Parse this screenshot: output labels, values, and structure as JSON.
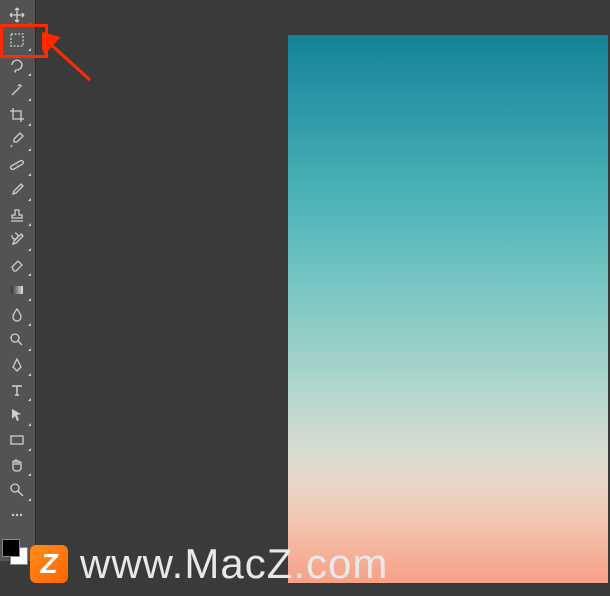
{
  "toolbar": {
    "tools": [
      {
        "name": "move-tool",
        "kind": "move"
      },
      {
        "name": "marquee-tool",
        "kind": "marquee",
        "highlighted": true
      },
      {
        "name": "lasso-tool",
        "kind": "lasso"
      },
      {
        "name": "magic-wand-tool",
        "kind": "wand"
      },
      {
        "name": "crop-tool",
        "kind": "crop"
      },
      {
        "name": "eyedropper-tool",
        "kind": "eyedropper"
      },
      {
        "name": "healing-brush-tool",
        "kind": "bandage"
      },
      {
        "name": "brush-tool",
        "kind": "brush"
      },
      {
        "name": "clone-stamp-tool",
        "kind": "stamp"
      },
      {
        "name": "history-brush-tool",
        "kind": "historybrush"
      },
      {
        "name": "eraser-tool",
        "kind": "eraser"
      },
      {
        "name": "gradient-tool",
        "kind": "gradient"
      },
      {
        "name": "blur-tool",
        "kind": "drop"
      },
      {
        "name": "dodge-tool",
        "kind": "dodge"
      },
      {
        "name": "pen-tool",
        "kind": "pen"
      },
      {
        "name": "type-tool",
        "kind": "type"
      },
      {
        "name": "path-selection-tool",
        "kind": "arrow"
      },
      {
        "name": "rectangle-tool",
        "kind": "rect"
      },
      {
        "name": "hand-tool",
        "kind": "hand"
      },
      {
        "name": "zoom-tool",
        "kind": "zoom"
      },
      {
        "name": "edit-toolbar",
        "kind": "dots"
      }
    ],
    "foreground_color": "#000000",
    "background_color": "#ffffff"
  },
  "annotation": {
    "highlight_tool": "marquee-tool",
    "highlight_color": "#ff2a00"
  },
  "watermark": {
    "badge": "Z",
    "text": "www.MacZ.com"
  }
}
